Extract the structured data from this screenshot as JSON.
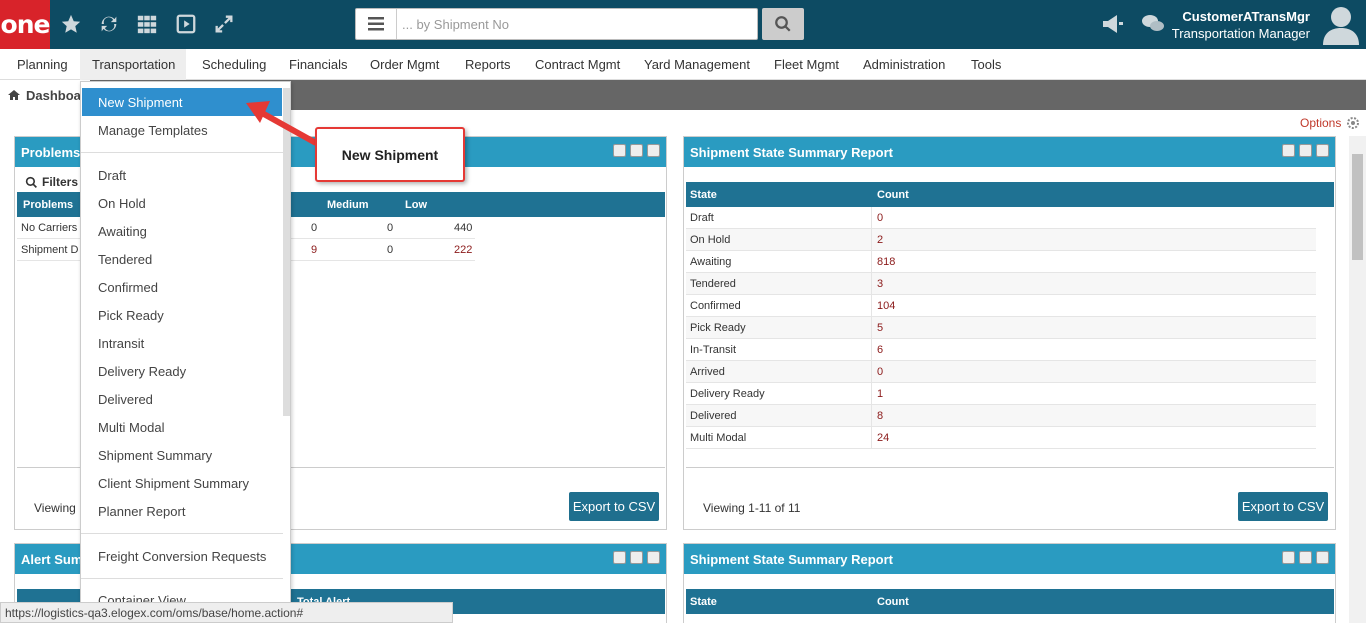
{
  "header": {
    "logo": "one",
    "search_placeholder": "... by Shipment No",
    "user_name": "CustomerATransMgr",
    "user_role": "Transportation Manager"
  },
  "nav": [
    "Planning",
    "Transportation",
    "Scheduling",
    "Financials",
    "Order Mgmt",
    "Reports",
    "Contract Mgmt",
    "Yard Management",
    "Fleet Mgmt",
    "Administration",
    "Tools"
  ],
  "breadcrumb": "Dashboa",
  "options_label": "Options",
  "dropdown": {
    "items": [
      "New Shipment",
      "Manage Templates",
      "Draft",
      "On Hold",
      "Awaiting",
      "Tendered",
      "Confirmed",
      "Pick Ready",
      "Intransit",
      "Delivery Ready",
      "Delivered",
      "Multi Modal",
      "Shipment Summary",
      "Client Shipment Summary",
      "Planner Report",
      "Freight Conversion Requests",
      "Container View"
    ]
  },
  "callout": "New Shipment",
  "problems_panel": {
    "title": "Problems",
    "filters": "Filters",
    "headers": [
      "Problems",
      "Medium",
      "Low"
    ],
    "rows": [
      {
        "name": "No Carriers",
        "c1": "0",
        "medium": "0",
        "low": "440"
      },
      {
        "name": "Shipment D",
        "c1": "9",
        "medium": "0",
        "low": "222"
      }
    ],
    "viewing": "Viewing",
    "export": "Export to CSV"
  },
  "summary_panel": {
    "title": "Shipment State Summary Report",
    "headers": [
      "State",
      "Count"
    ],
    "rows": [
      {
        "state": "Draft",
        "count": "0"
      },
      {
        "state": "On Hold",
        "count": "2"
      },
      {
        "state": "Awaiting",
        "count": "818"
      },
      {
        "state": "Tendered",
        "count": "3"
      },
      {
        "state": "Confirmed",
        "count": "104"
      },
      {
        "state": "Pick Ready",
        "count": "5"
      },
      {
        "state": "In-Transit",
        "count": "6"
      },
      {
        "state": "Arrived",
        "count": "0"
      },
      {
        "state": "Delivery Ready",
        "count": "1"
      },
      {
        "state": "Delivered",
        "count": "8"
      },
      {
        "state": "Multi Modal",
        "count": "24"
      }
    ],
    "viewing": "Viewing 1-11 of 11",
    "export": "Export to CSV"
  },
  "alert_panel": {
    "title": "Alert Sum",
    "h1": "Total Alert"
  },
  "summary_panel2": {
    "title": "Shipment State Summary Report",
    "headers": [
      "State",
      "Count"
    ]
  },
  "status_url": "https://logistics-qa3.elogex.com/oms/base/home.action#"
}
